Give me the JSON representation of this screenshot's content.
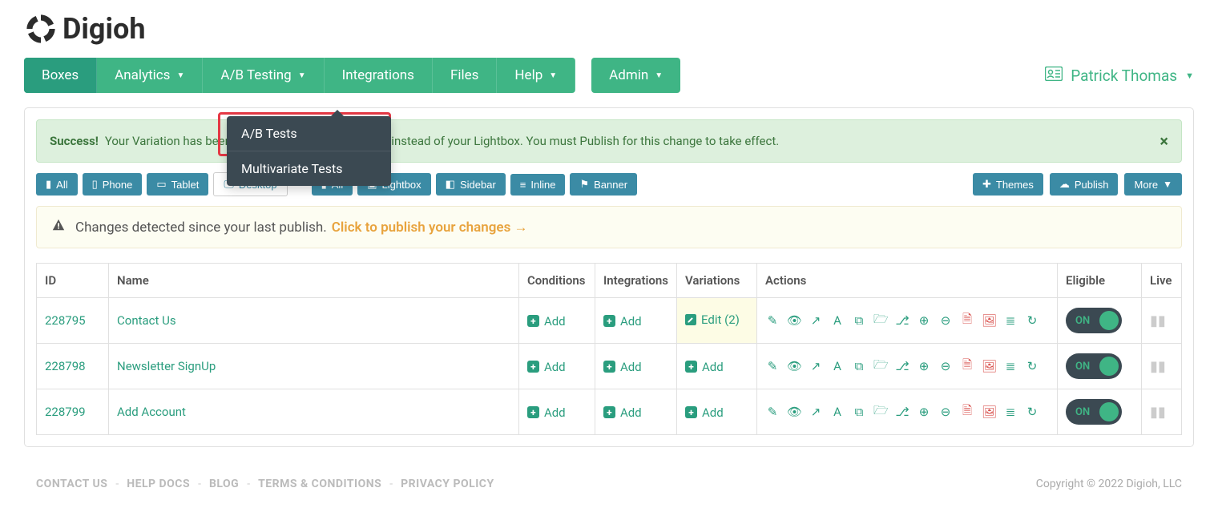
{
  "brand": "Digioh",
  "nav": {
    "items": [
      "Boxes",
      "Analytics",
      "A/B Testing",
      "Integrations",
      "Files",
      "Help"
    ],
    "admin": "Admin",
    "user": "Patrick Thomas"
  },
  "dropdown": {
    "items": [
      "A/B Tests",
      "Multivariate Tests"
    ]
  },
  "alerts": {
    "success_title": "Success!",
    "success_body": "Your Variation has been created and will be displayed instead of your Lightbox. You must Publish for this change to take effect.",
    "warn_text": "Changes detected since your last publish.",
    "warn_link": "Click to publish your changes →"
  },
  "filters": {
    "device": [
      "All",
      "Phone",
      "Tablet",
      "Desktop"
    ],
    "type": [
      "All",
      "Lightbox",
      "Sidebar",
      "Inline",
      "Banner"
    ],
    "themes": "Themes",
    "publish": "Publish",
    "more": "More"
  },
  "table": {
    "headers": [
      "ID",
      "Name",
      "Conditions",
      "Integrations",
      "Variations",
      "Actions",
      "Eligible",
      "Live"
    ],
    "add_label": "Add",
    "edit_label": "Edit (2)",
    "on_label": "ON",
    "rows": [
      {
        "id": "228795",
        "name": "Contact Us",
        "var_edit": true
      },
      {
        "id": "228798",
        "name": "Newsletter SignUp",
        "var_edit": false
      },
      {
        "id": "228799",
        "name": "Add Account",
        "var_edit": false
      }
    ]
  },
  "footer": {
    "links": [
      "CONTACT US",
      "HELP DOCS",
      "BLOG",
      "TERMS & CONDITIONS",
      "PRIVACY POLICY"
    ],
    "copyright": "Copyright © 2022 Digioh, LLC"
  }
}
